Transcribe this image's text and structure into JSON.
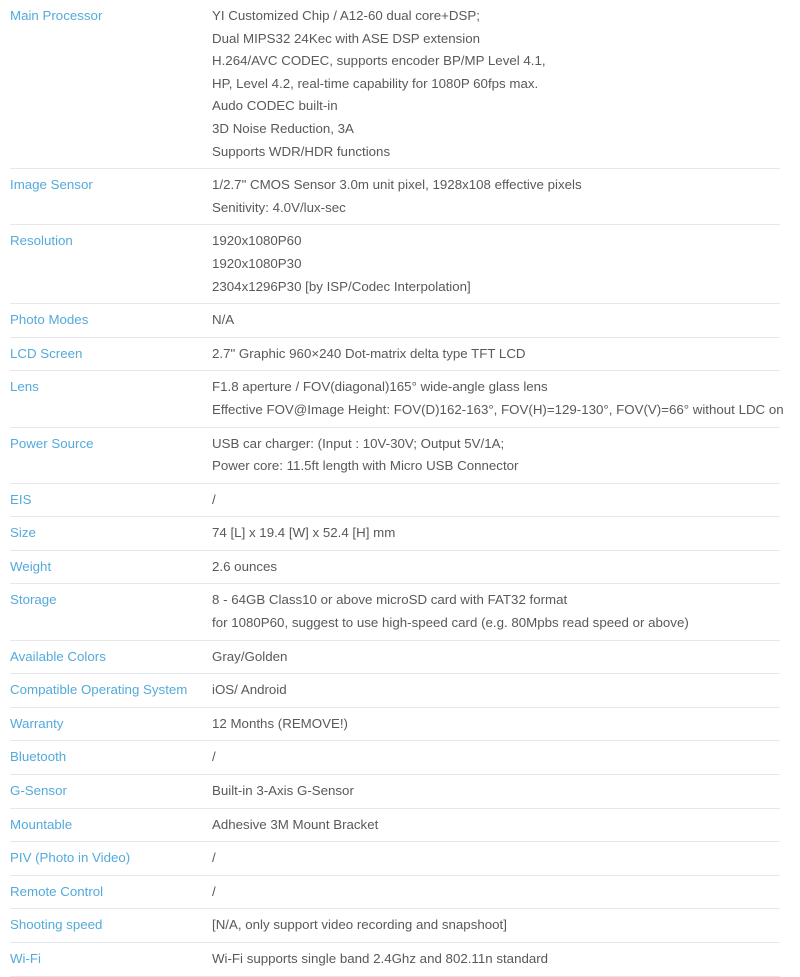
{
  "document": {
    "type": "product-specification-table",
    "label_color": "#53aadb",
    "value_color": "#58595b",
    "divider_color": "#e6e7e8",
    "background_color": "#ffffff"
  },
  "rows": [
    {
      "label": "Main Processor",
      "value_lines": [
        "YI Customized Chip / A12-60 dual core+DSP;",
        "Dual MIPS32 24Kec with ASE DSP extension",
        "H.264/AVC CODEC, supports encoder BP/MP Level 4.1,",
        "HP, Level 4.2, real-time capability for 1080P 60fps max.",
        "Audo CODEC built-in",
        "3D Noise Reduction, 3A",
        "Supports WDR/HDR functions"
      ]
    },
    {
      "label": "Image Sensor",
      "value_lines": [
        "1/2.7\" CMOS Sensor 3.0m unit pixel, 1928x108 effective pixels",
        "Senitivity: 4.0V/lux-sec"
      ]
    },
    {
      "label": "Resolution",
      "value_lines": [
        "1920x1080P60",
        "1920x1080P30",
        "2304x1296P30 [by ISP/Codec Interpolation]"
      ]
    },
    {
      "label": "Photo Modes",
      "value_lines": [
        "N/A"
      ]
    },
    {
      "label": "LCD Screen",
      "value_lines": [
        "2.7\" Graphic 960×240 Dot-matrix delta type TFT LCD"
      ]
    },
    {
      "label": "Lens",
      "value_lines": [
        "F1.8 aperture / FOV(diagonal)165° wide-angle glass lens",
        "Effective FOV@Image Height: FOV(D)162-163°, FOV(H)=129-130°, FOV(V)=66° without LDC on"
      ]
    },
    {
      "label": "Power Source",
      "value_lines": [
        "USB car charger: (Input : 10V-30V; Output 5V/1A;",
        "Power core: 11.5ft length with Micro USB Connector"
      ]
    },
    {
      "label": "EIS",
      "value_lines": [
        "/"
      ]
    },
    {
      "label": "Size",
      "value_lines": [
        "74 [L] x 19.4 [W] x 52.4 [H] mm"
      ]
    },
    {
      "label": "Weight",
      "value_lines": [
        "2.6 ounces"
      ]
    },
    {
      "label": "Storage",
      "value_lines": [
        "8 - 64GB Class10 or above microSD card with FAT32 format",
        "for 1080P60, suggest to use high-speed card (e.g. 80Mpbs read speed or above)"
      ]
    },
    {
      "label": "Available Colors",
      "value_lines": [
        "Gray/Golden"
      ]
    },
    {
      "label": "Compatible Operating System",
      "value_lines": [
        "iOS/ Android"
      ]
    },
    {
      "label": "Warranty",
      "value_lines": [
        "12 Months (REMOVE!)"
      ]
    },
    {
      "label": "Bluetooth",
      "value_lines": [
        "/"
      ]
    },
    {
      "label": "G-Sensor",
      "value_lines": [
        "Built-in 3-Axis G-Sensor"
      ]
    },
    {
      "label": "Mountable",
      "value_lines": [
        "Adhesive 3M Mount Bracket"
      ]
    },
    {
      "label": "PIV (Photo in Video)",
      "value_lines": [
        "/"
      ]
    },
    {
      "label": "Remote Control",
      "value_lines": [
        "/"
      ]
    },
    {
      "label": "Shooting speed",
      "value_lines": [
        "[N/A, only support video recording and snapshoot]"
      ]
    },
    {
      "label": "Wi-Fi",
      "value_lines": [
        "Wi-Fi supports single band 2.4Ghz and 802.11n standard"
      ]
    }
  ]
}
